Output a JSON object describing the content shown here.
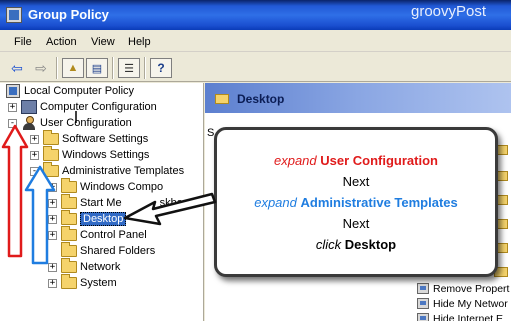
{
  "window": {
    "title": "Group Policy",
    "watermark": "groovyPost"
  },
  "menu": [
    "File",
    "Action",
    "View",
    "Help"
  ],
  "tree": {
    "root": "Local Computer Policy",
    "computer_configuration": "Computer Configuration",
    "user_configuration": "User Configuration",
    "software_settings": "Software Settings",
    "windows_settings": "Windows Settings",
    "administrative_templates": "Administrative Templates",
    "windows_components": "Windows Compo",
    "start_menu": "Start Me",
    "taskbar_fragment": "skbar",
    "desktop": "Desktop",
    "control_panel": "Control Panel",
    "shared_folders": "Shared Folders",
    "network": "Network",
    "system": "System"
  },
  "right_pane": {
    "header_title": "Desktop",
    "setting_fragment": "S",
    "settings": [
      "Remove Propert",
      "Hide My Networ",
      "Hide Internet E"
    ]
  },
  "callout": {
    "line1_verb": "expand",
    "line1_target": "User Configuration",
    "line2": "Next",
    "line3_verb": "expand",
    "line3_target": "Administrative Templates",
    "line4": "Next",
    "line5_verb": "click",
    "line5_target": "Desktop"
  }
}
